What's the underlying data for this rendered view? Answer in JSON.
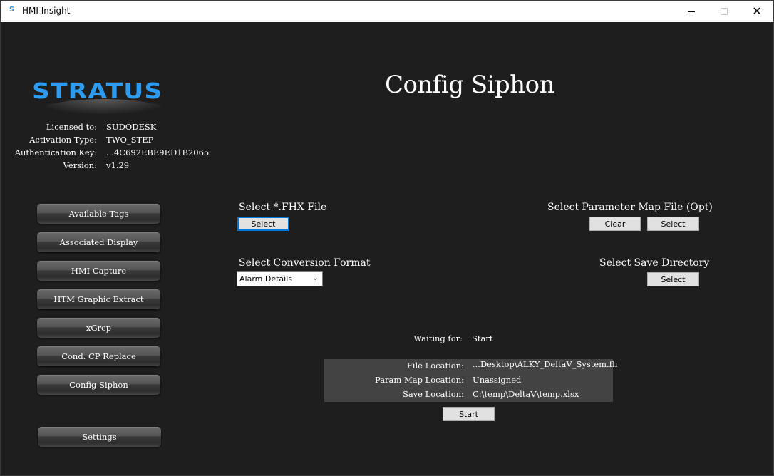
{
  "window": {
    "app_icon": "stratus-s-icon",
    "title": "HMI Insight",
    "controls": {
      "minimize": "minimize-icon",
      "maximize": "maximize-icon",
      "close": "✕"
    }
  },
  "logo": {
    "text": "STRATUS"
  },
  "license": {
    "rows": [
      {
        "label": "Licensed to:",
        "value": "SUDODESK"
      },
      {
        "label": "Activation Type:",
        "value": "TWO_STEP"
      },
      {
        "label": "Authentication Key:",
        "value": "...4C692EBE9ED1B2065"
      },
      {
        "label": "Version:",
        "value": "v1.29"
      }
    ]
  },
  "nav": {
    "items": [
      {
        "label": "Available Tags"
      },
      {
        "label": "Associated Display"
      },
      {
        "label": "HMI Capture"
      },
      {
        "label": "HTM Graphic Extract"
      },
      {
        "label": "xGrep"
      },
      {
        "label": "Cond. CP Replace"
      },
      {
        "label": "Config Siphon"
      }
    ],
    "settings_label": "Settings"
  },
  "main": {
    "title": "Config Siphon",
    "fhx": {
      "label": "Select *.FHX File",
      "select_button": "Select"
    },
    "param_map": {
      "label": "Select Parameter Map File (Opt)",
      "clear_button": "Clear",
      "select_button": "Select"
    },
    "conversion": {
      "label": "Select Conversion Format",
      "selected": "Alarm Details"
    },
    "save_dir": {
      "label": "Select Save Directory",
      "select_button": "Select"
    },
    "status": {
      "label": "Waiting for:",
      "value": "Start"
    },
    "locations": [
      {
        "label": "File Location:",
        "value": "...Desktop\\ALKY_DeltaV_System.fh"
      },
      {
        "label": "Param Map Location:",
        "value": "Unassigned"
      },
      {
        "label": "Save Location:",
        "value": "C:\\temp\\DeltaV\\temp.xlsx"
      }
    ],
    "start_button": "Start"
  }
}
